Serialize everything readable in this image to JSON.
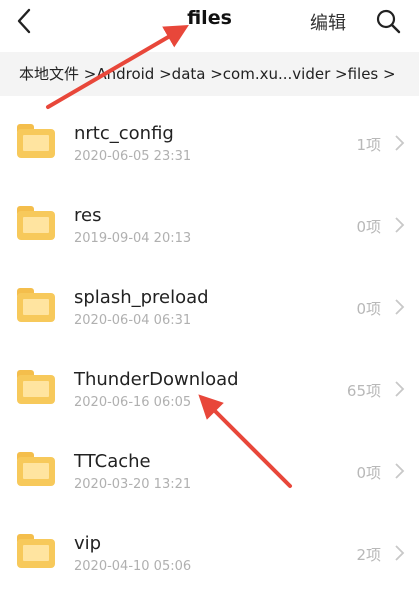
{
  "header": {
    "title": "files",
    "edit_label": "编辑"
  },
  "breadcrumb": {
    "path": "本地文件 >Android >data >com.xu...vider >files >"
  },
  "folders": [
    {
      "name": "nrtc_config",
      "date": "2020-06-05 23:31",
      "count": "1项"
    },
    {
      "name": "res",
      "date": "2019-09-04 20:13",
      "count": "0项"
    },
    {
      "name": "splash_preload",
      "date": "2020-06-04 06:31",
      "count": "0项"
    },
    {
      "name": "ThunderDownload",
      "date": "2020-06-16 06:05",
      "count": "65项"
    },
    {
      "name": "TTCache",
      "date": "2020-03-20 13:21",
      "count": "0项"
    },
    {
      "name": "vip",
      "date": "2020-04-10 05:06",
      "count": "2项"
    }
  ],
  "colors": {
    "folder": "#f7c95b",
    "folder_tab": "#f4be4c",
    "annotation_arrow": "#e8473a",
    "breadcrumb_bg": "#f4f4f4"
  }
}
